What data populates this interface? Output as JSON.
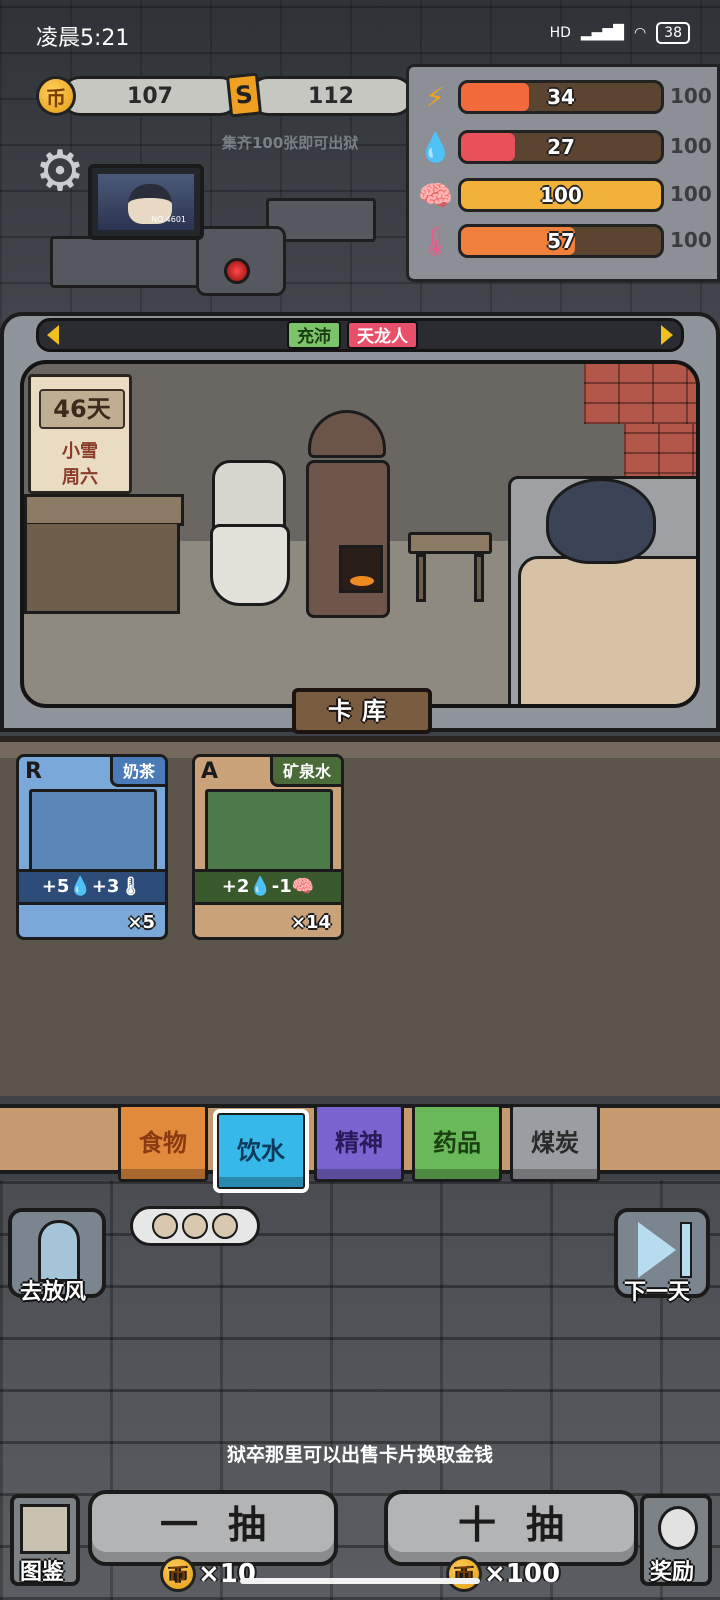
{
  "status_bar": {
    "time": "凌晨5:21",
    "network": "HD",
    "battery": "38"
  },
  "currency": {
    "coins": "107",
    "coin_icon": "币",
    "tickets": "112",
    "ticket_icon": "S",
    "hint": "集齐100张即可出狱"
  },
  "stats": [
    {
      "icon": "energy-icon",
      "glyph": "⚡",
      "value": "34",
      "max": "100",
      "fill": 0.34,
      "color": "#f06a3c",
      "icon_color": "#f0a020"
    },
    {
      "icon": "water-icon",
      "glyph": "💧",
      "value": "27",
      "max": "100",
      "fill": 0.27,
      "color": "#e8505a",
      "icon_color": "#3f8fe0"
    },
    {
      "icon": "brain-icon",
      "glyph": "🧠",
      "value": "100",
      "max": "100",
      "fill": 1.0,
      "color": "#f2b23a",
      "icon_color": "#8a74e0"
    },
    {
      "icon": "thermometer-icon",
      "glyph": "🌡",
      "value": "57",
      "max": "100",
      "fill": 0.57,
      "color": "#f0803c",
      "icon_color": "#e85a8a"
    }
  ],
  "monitor": {
    "number": "NO.4601"
  },
  "tags": [
    {
      "label": "充沛",
      "bg": "#7cc46a",
      "color": "#1a3a10"
    },
    {
      "label": "天龙人",
      "bg": "#e8506a",
      "color": "#ffffff"
    }
  ],
  "calendar": {
    "day": "46天",
    "weather": "小雪",
    "weekday": "周六"
  },
  "card_library_label": "卡库",
  "cards": [
    {
      "rank": "R",
      "name": "奶茶",
      "effect": "+5💧+3🌡",
      "count": "×5",
      "theme": "#7aa8d8",
      "tab": "#4a7ab8",
      "art": "#5a86b8",
      "effect_bg": "#2e4c7a"
    },
    {
      "rank": "A",
      "name": "矿泉水",
      "effect": "+2💧-1🧠",
      "count": "×14",
      "theme": "#caa27a",
      "tab": "#4a6a3a",
      "art": "#4e7a4a",
      "effect_bg": "#3a5a2e"
    }
  ],
  "categories": [
    {
      "label": "食物",
      "bg": "#e28a3c",
      "text": "#8a3a10",
      "active": false
    },
    {
      "label": "饮水",
      "bg": "#36b8e8",
      "text": "#0c3a5a",
      "active": true
    },
    {
      "label": "精神",
      "bg": "#7c64d0",
      "text": "#2a1a5a",
      "active": false
    },
    {
      "label": "药品",
      "bg": "#6ab85a",
      "text": "#1a4010",
      "active": false
    },
    {
      "label": "煤炭",
      "bg": "#9a9da2",
      "text": "#2a2a2a",
      "active": false
    }
  ],
  "side_buttons": {
    "outing": "去放风",
    "next_day": "下一天"
  },
  "tip": "狱卒那里可以出售卡片换取金钱",
  "draw": {
    "single": "一抽",
    "single_cost": "×10",
    "ten": "十抽",
    "ten_cost": "×100"
  },
  "bottom_buttons": {
    "codex": "图鉴",
    "reward": "奖励"
  }
}
